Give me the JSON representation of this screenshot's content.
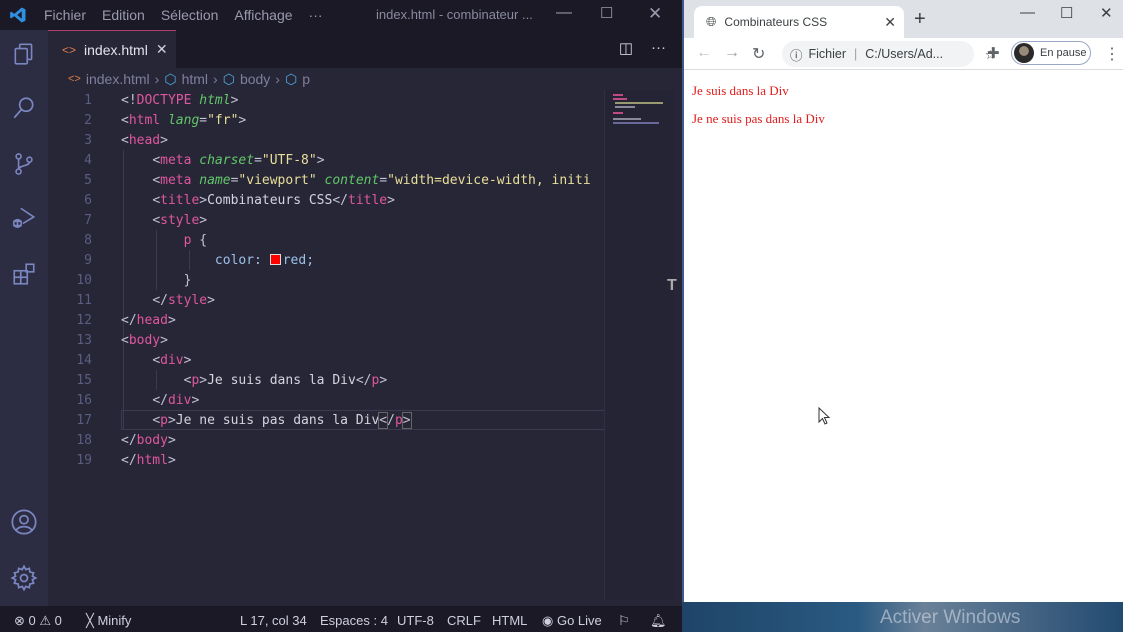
{
  "vscode": {
    "menu": [
      "Fichier",
      "Edition",
      "Sélection",
      "Affichage",
      "···"
    ],
    "window_title": "index.html - combinateur ...",
    "tab": {
      "label": "index.html",
      "close": "✕"
    },
    "breadcrumb": [
      "index.html",
      "html",
      "body",
      "p"
    ],
    "lines": [
      {
        "n": "1"
      },
      {
        "n": "2"
      },
      {
        "n": "3"
      },
      {
        "n": "4"
      },
      {
        "n": "5"
      },
      {
        "n": "6"
      },
      {
        "n": "7"
      },
      {
        "n": "8"
      },
      {
        "n": "9"
      },
      {
        "n": "10"
      },
      {
        "n": "11"
      },
      {
        "n": "12"
      },
      {
        "n": "13"
      },
      {
        "n": "14"
      },
      {
        "n": "15"
      },
      {
        "n": "16"
      },
      {
        "n": "17"
      },
      {
        "n": "18"
      },
      {
        "n": "19"
      }
    ],
    "code_tokens": {
      "doctype": "DOCTYPE",
      "html_kw": "html",
      "html": "html",
      "lang": "lang",
      "fr": "\"fr\"",
      "head": "head",
      "meta": "meta",
      "charset": "charset",
      "utf8": "\"UTF-8\"",
      "name": "name",
      "viewport": "\"viewport\"",
      "content": "content",
      "content_val": "\"width=device-width, initi",
      "title": "title",
      "title_text": "Combinateurs CSS",
      "style": "style",
      "p": "p",
      "color_prop": "color:",
      "color_val": "red;",
      "div": "div",
      "p1_text": "Je suis dans la Div",
      "p2_text": "Je ne suis pas dans la Div",
      "body": "body"
    },
    "swatch_color": "#ff0000",
    "status": {
      "errors": "0",
      "warnings": "0",
      "minify": "Minify",
      "position": "L 17, col 34",
      "spaces": "Espaces : 4",
      "encoding": "UTF-8",
      "eol": "CRLF",
      "language": "HTML",
      "golive": "Go Live"
    }
  },
  "browser": {
    "tab_title": "Combinateurs CSS",
    "address_scheme": "Fichier",
    "address": "C:/Users/Ad...",
    "profile": "En pause",
    "page_paragraphs": [
      "Je suis dans la Div",
      "Je ne suis pas dans la Div"
    ],
    "text_color": "#e01d1d"
  },
  "taskbar": {
    "watermark": "Activer Windows"
  }
}
